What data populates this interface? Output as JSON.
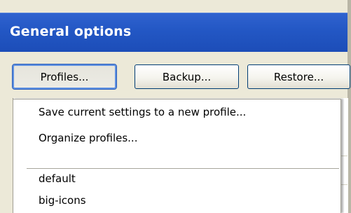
{
  "header": {
    "title": "General options"
  },
  "toolbar": {
    "profiles_label": "Profiles...",
    "backup_label": "Backup...",
    "restore_label": "Restore..."
  },
  "profiles_menu": {
    "actions": [
      "Save current settings to a new profile...",
      "Organize profiles..."
    ],
    "profiles": [
      "default",
      "big-icons"
    ]
  }
}
